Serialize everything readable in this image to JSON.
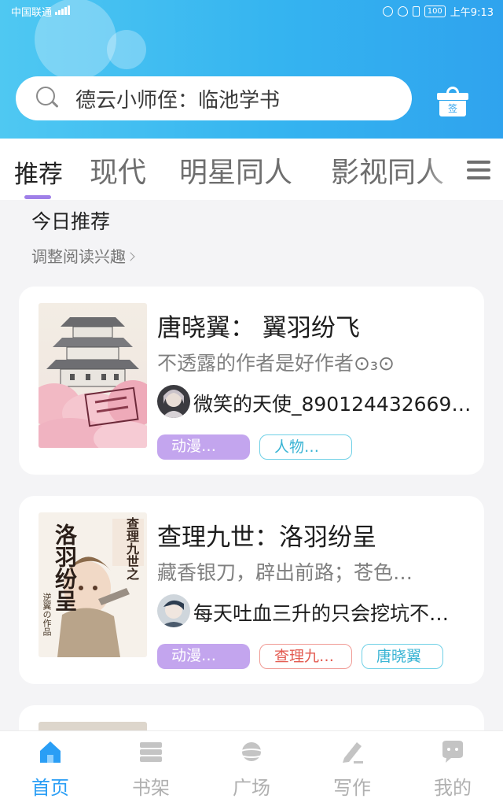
{
  "status_bar": {
    "carrier": "中国联通",
    "battery": "100",
    "time": "上午9:13"
  },
  "search": {
    "icon": "search-icon",
    "query": "德云小师侄：临池学书"
  },
  "checkin": {
    "label": "签",
    "icon": "gift-icon"
  },
  "tabs": {
    "items": [
      "推荐",
      "现代",
      "明星同人",
      "影视同人"
    ],
    "active_index": 0,
    "menu_icon": "menu-icon"
  },
  "section": {
    "title": "今日推荐",
    "subtitle": "调整阅读兴趣"
  },
  "books": [
    {
      "title": "唐晓翼： 翼羽纷飞",
      "desc": "不透露的作者是好作者",
      "desc_emoji": "⊙₃⊙",
      "author": "微笑的天使_890124432669…",
      "tags": [
        "动漫…",
        "人物…"
      ]
    },
    {
      "title": "查理九世：洛羽纷呈",
      "desc": "藏香银刀，辟出前路；苍色…",
      "author": "每天吐血三升的只会挖坑不…",
      "tags": [
        "动漫…",
        "查理九…",
        "唐晓翼"
      ],
      "cover_text": {
        "main": "洛羽纷呈",
        "side": "查理九世之",
        "credit": "逆翼の作品"
      }
    }
  ],
  "bottom_nav": {
    "items": [
      {
        "label": "首页",
        "icon": "home-icon"
      },
      {
        "label": "书架",
        "icon": "bookshelf-icon"
      },
      {
        "label": "广场",
        "icon": "planet-icon"
      },
      {
        "label": "写作",
        "icon": "pen-icon"
      },
      {
        "label": "我的",
        "icon": "chat-bubble-icon"
      }
    ],
    "active_index": 0
  },
  "colors": {
    "header_start": "#4fc8f2",
    "header_end": "#2fa3ee",
    "accent_purple": "#9f7fe8",
    "tag_purple": "#c3a5ee",
    "tag_cyan": "#39b4d4",
    "tag_red": "#e35a50",
    "nav_active": "#2a9ef5"
  }
}
